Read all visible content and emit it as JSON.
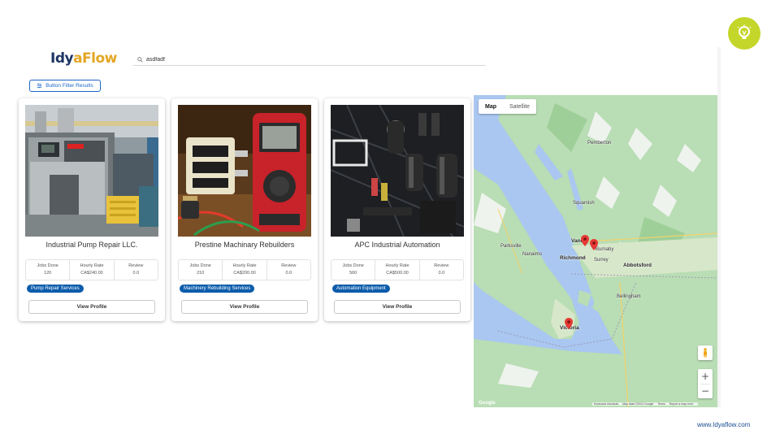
{
  "brand": {
    "logo_part1": "Idy",
    "logo_part2": "aFlow",
    "footer_url": "www.Idyaflow.com"
  },
  "search": {
    "value": "asdfadf",
    "icon": "search-icon"
  },
  "filter_button": {
    "label": "Button Filter Results",
    "icon": "sliders-icon"
  },
  "cards": [
    {
      "title": "Industrial Pump Repair LLC.",
      "stats": {
        "jobs_label": "Jobs Done",
        "jobs_value": "120",
        "rate_label": "Hourly Rate",
        "rate_value": "CA$240.00",
        "review_label": "Review",
        "review_value": "0.0"
      },
      "tag": "Pump Repair Services",
      "button": "View Profile"
    },
    {
      "title": "Prestine Machinary Rebuilders",
      "stats": {
        "jobs_label": "Jobs Done",
        "jobs_value": "210",
        "rate_label": "Hourly Rate",
        "rate_value": "CA$200.00",
        "review_label": "Review",
        "review_value": "0.0"
      },
      "tag": "Machinery Rebuilding Services",
      "button": "View Profile"
    },
    {
      "title": "APC Industrial Automation",
      "stats": {
        "jobs_label": "Jobs Done",
        "jobs_value": "560",
        "rate_label": "Hourly Rate",
        "rate_value": "CA$500.00",
        "review_label": "Review",
        "review_value": "0.0"
      },
      "tag": "Automation Equipment",
      "button": "View Profile"
    }
  ],
  "map": {
    "tabs": {
      "map": "Map",
      "satellite": "Satellite"
    },
    "labels": {
      "vancouver": "Vanc",
      "richmond": "Richmond",
      "burnaby": "Burnaby",
      "surrey": "Surrey",
      "abbotsford": "Abbotsford",
      "nanaimo": "Nanaimo",
      "victoria": "Victoria",
      "squamish": "Squamish",
      "pemberton": "Pemberton",
      "parksville": "Parksville",
      "bellingham": "Bellingham"
    },
    "zoom_in": "+",
    "zoom_out": "−",
    "google": "Google",
    "attribution": {
      "shortcuts": "Keyboard shortcuts",
      "data": "Map data ©2024 Google",
      "terms": "Terms",
      "report": "Report a map error"
    }
  },
  "colors": {
    "accent_blue": "#0b5cab",
    "logo_navy": "#1d3563",
    "logo_gold": "#e4a623",
    "badge_green": "#c4d62a",
    "water": "#a9c7f0",
    "land": "#b9ddb4",
    "pin_red": "#e53935"
  }
}
